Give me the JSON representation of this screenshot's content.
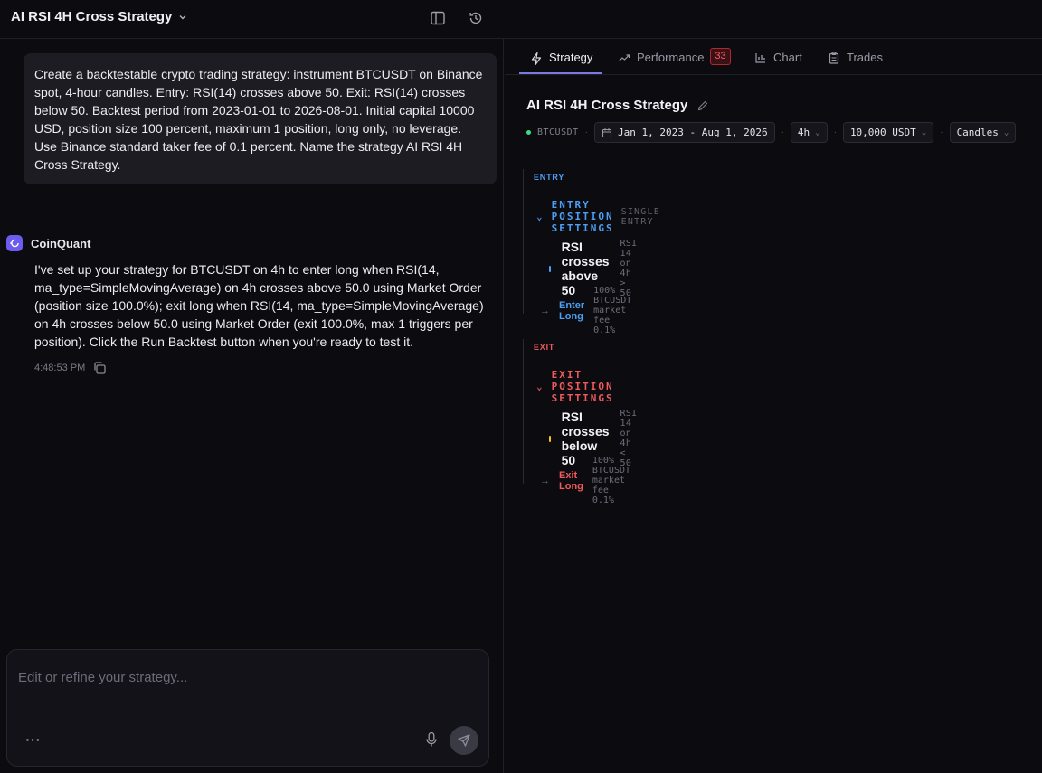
{
  "header": {
    "title": "AI RSI 4H Cross Strategy"
  },
  "chat": {
    "user_message": "Create a backtestable crypto trading strategy: instrument BTCUSDT on Binance spot, 4-hour candles. Entry: RSI(14) crosses above 50. Exit: RSI(14) crosses below 50. Backtest period from 2023-01-01 to 2026-08-01. Initial capital 10000 USD, position size 100 percent, maximum 1 position, long only, no leverage. Use Binance standard taker fee of 0.1 percent. Name the strategy AI RSI 4H Cross Strategy.",
    "bot_name": "CoinQuant",
    "bot_message": "I've set up your strategy for BTCUSDT on 4h to enter long when RSI(14, ma_type=SimpleMovingAverage) on 4h crosses above 50.0 using Market Order (position size 100.0%); exit long when RSI(14, ma_type=SimpleMovingAverage) on 4h crosses below 50.0 using Market Order (exit 100.0%, max 1 triggers per position). Click the Run Backtest button when you're ready to test it.",
    "bot_time": "4:48:53 PM",
    "composer_placeholder": "Edit or refine your strategy...",
    "more_label": "···"
  },
  "tabs": [
    {
      "label": "Strategy",
      "icon": "lightning-icon",
      "active": true
    },
    {
      "label": "Performance",
      "icon": "trend-icon",
      "badge": "33"
    },
    {
      "label": "Chart",
      "icon": "chart-icon"
    },
    {
      "label": "Trades",
      "icon": "clipboard-icon"
    }
  ],
  "strategy": {
    "title": "AI RSI 4H Cross Strategy",
    "symbol": "BTCUSDT",
    "date_range": "Jan 1, 2023 - Aug 1, 2026",
    "timeframe": "4h",
    "capital": "10,000 USDT",
    "view": "Candles",
    "entry": {
      "tag": "ENTRY",
      "heading": "ENTRY POSITION SETTINGS",
      "sub": "SINGLE ENTRY",
      "condition": "RSI crosses above 50",
      "condition_desc": "RSI 14 on 4h > 50",
      "action": "Enter Long",
      "action_desc": "100% BTCUSDT market fee 0.1%"
    },
    "exit": {
      "tag": "EXIT",
      "heading": "EXIT POSITION SETTINGS",
      "condition": "RSI crosses below 50",
      "condition_desc": "RSI 14 on 4h < 50",
      "action": "Exit Long",
      "action_desc": "100% BTCUSDT market fee 0.1%"
    }
  },
  "colors": {
    "entry_blue": "#4d9ff5",
    "exit_red": "#f05a5a",
    "entry_dot": "#4d9ff5",
    "exit_dot": "#f5c518",
    "accent": "#7a7ae0"
  }
}
